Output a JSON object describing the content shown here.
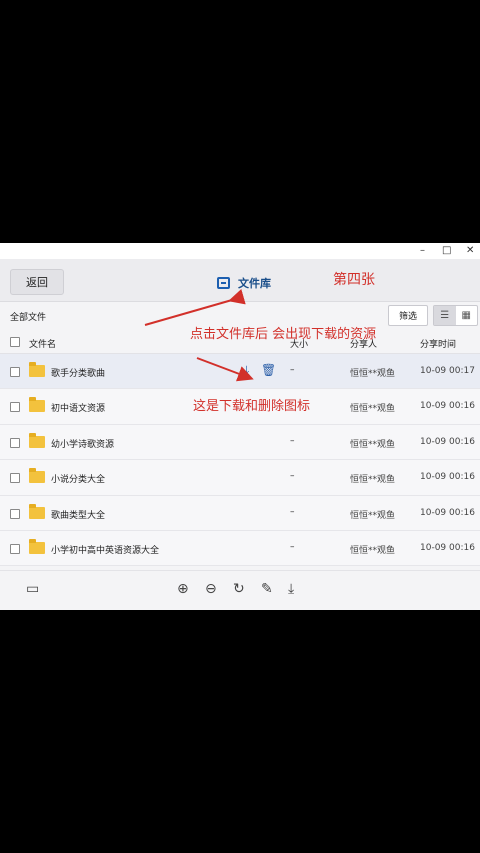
{
  "window": {
    "controls": [
      "–",
      "□",
      "✕"
    ]
  },
  "header": {
    "back_label": "返回",
    "library_title": "文件库",
    "library_icon": "monitor-icon"
  },
  "annotations": {
    "page_tag": "第四张",
    "note_library": "点击文件库后 会出现下载的资源",
    "note_icons": "这是下载和删除图标",
    "color": "#d2302a"
  },
  "toolbar": {
    "breadcrumb": "全部文件",
    "filter_label": "筛选",
    "view_modes": [
      "list-view-icon",
      "grid-view-icon"
    ],
    "active_view": "list"
  },
  "table": {
    "columns": {
      "name": "文件名",
      "size": "大小",
      "sharer": "分享人",
      "time": "分享时间"
    },
    "rows": [
      {
        "name": "歌手分类歌曲",
        "size": "–",
        "sharer": "恒恒**观鱼",
        "time": "10-09 00:17"
      },
      {
        "name": "初中语文资源",
        "size": "",
        "sharer": "恒恒**观鱼",
        "time": "10-09 00:16"
      },
      {
        "name": "幼小学诗歌资源",
        "size": "–",
        "sharer": "恒恒**观鱼",
        "time": "10-09 00:16"
      },
      {
        "name": "小说分类大全",
        "size": "–",
        "sharer": "恒恒**观鱼",
        "time": "10-09 00:16"
      },
      {
        "name": "歌曲类型大全",
        "size": "–",
        "sharer": "恒恒**观鱼",
        "time": "10-09 00:16"
      },
      {
        "name": "小学初中高中英语资源大全",
        "size": "–",
        "sharer": "恒恒**观鱼",
        "time": "10-09 00:16"
      }
    ],
    "row_actions": [
      "download-icon",
      "trash-icon"
    ]
  },
  "bottom_toolbar": {
    "icons": [
      "save-icon",
      "zoom-in-icon",
      "zoom-out-icon",
      "rotate-icon",
      "edit-icon",
      "download-icon"
    ]
  },
  "colors": {
    "accent": "#1d5fb0",
    "folder": "#f3c23d",
    "annotation": "#d2302a"
  }
}
